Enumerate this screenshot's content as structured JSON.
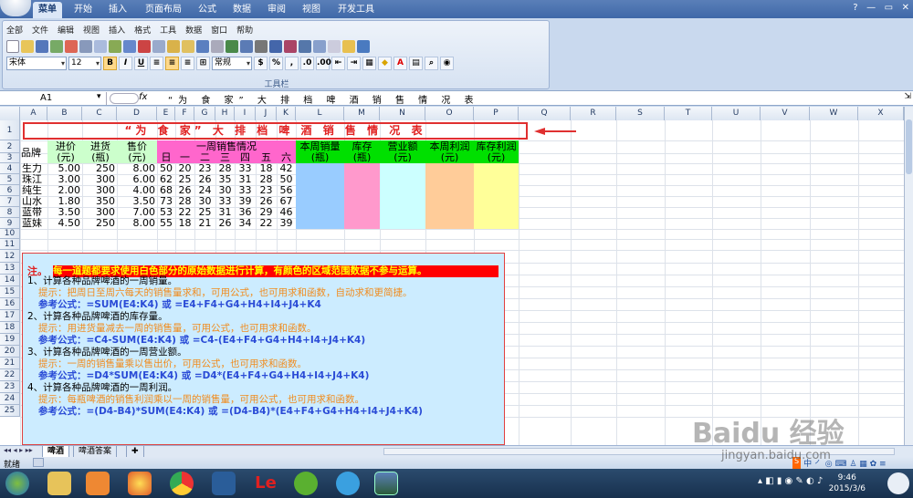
{
  "ribbon": {
    "tabs": [
      "菜单",
      "开始",
      "插入",
      "页面布局",
      "公式",
      "数据",
      "审阅",
      "视图",
      "开发工具"
    ],
    "active_tab": "菜单"
  },
  "menu": [
    "全部",
    "文件",
    "编辑",
    "视图",
    "插入",
    "格式",
    "工具",
    "数据",
    "窗口",
    "帮助"
  ],
  "toolbar": {
    "font_name": "宋体",
    "font_size": "12",
    "bold": "B",
    "italic": "I",
    "underline": "U",
    "style": "常规",
    "caption": "工具栏"
  },
  "formula_bar": {
    "cell_ref": "A1",
    "fx": "fx",
    "value": "“为 食 家” 大 排 档 啤 酒 销 售 情 况 表"
  },
  "columns": [
    "A",
    "B",
    "C",
    "D",
    "E",
    "F",
    "G",
    "H",
    "I",
    "J",
    "K",
    "L",
    "M",
    "N",
    "O",
    "P",
    "Q",
    "R",
    "S",
    "T",
    "U",
    "V",
    "W",
    "X"
  ],
  "rows": [
    "1",
    "2",
    "3",
    "4",
    "5",
    "6",
    "7",
    "8",
    "9",
    "10",
    "11",
    "12",
    "13",
    "14",
    "15",
    "16",
    "17",
    "18",
    "19",
    "20",
    "21",
    "22",
    "23",
    "24",
    "25"
  ],
  "sheet": {
    "title": "“为 食 家” 大 排 档 啤 酒 销 售 情 况 表",
    "hdr_brand": "品牌",
    "hdr_buy": "进价",
    "hdr_buy_u": "(元)",
    "hdr_stock": "进货",
    "hdr_stock_u": "(瓶)",
    "hdr_sell": "售价",
    "hdr_sell_u": "(元)",
    "hdr_week": "一周销售情况",
    "days": [
      "日",
      "一",
      "二",
      "三",
      "四",
      "五",
      "六"
    ],
    "hdr_l1": "本周销量",
    "hdr_l2": "(瓶)",
    "hdr_m1": "库存",
    "hdr_m2": "(瓶)",
    "hdr_n1": "营业额",
    "hdr_n2": "(元)",
    "hdr_o1": "本周利润",
    "hdr_o2": "(元)",
    "hdr_p1": "库存利润",
    "hdr_p2": "(元)",
    "data": [
      {
        "brand": "生力",
        "buy": "5.00",
        "stock": "250",
        "sell": "8.00",
        "days": [
          "50",
          "20",
          "23",
          "28",
          "33",
          "18",
          "42"
        ]
      },
      {
        "brand": "珠江",
        "buy": "3.00",
        "stock": "300",
        "sell": "6.00",
        "days": [
          "62",
          "25",
          "26",
          "35",
          "31",
          "28",
          "50"
        ]
      },
      {
        "brand": "纯生",
        "buy": "2.00",
        "stock": "300",
        "sell": "4.00",
        "days": [
          "68",
          "26",
          "24",
          "30",
          "33",
          "23",
          "56"
        ]
      },
      {
        "brand": "山水",
        "buy": "1.80",
        "stock": "350",
        "sell": "3.50",
        "days": [
          "73",
          "28",
          "30",
          "33",
          "39",
          "26",
          "67"
        ]
      },
      {
        "brand": "蓝带",
        "buy": "3.50",
        "stock": "300",
        "sell": "7.00",
        "days": [
          "53",
          "22",
          "25",
          "31",
          "36",
          "29",
          "46"
        ]
      },
      {
        "brand": "蓝妹",
        "buy": "4.50",
        "stock": "250",
        "sell": "8.00",
        "days": [
          "55",
          "18",
          "21",
          "26",
          "34",
          "22",
          "39"
        ]
      }
    ],
    "notes": {
      "lead": "注。",
      "red_banner": "每一道题都要求使用白色部分的原始数据进行计算，有颜色的区域范围数据不参与运算。",
      "q1": "1、计算各种品牌啤酒的一周销量。",
      "h1": "提示：把周日至周六每天的销售量求和，可用公式，也可用求和函数，自动求和更简捷。",
      "f1": "参考公式：=SUM(E4:K4)   或    =E4+F4+G4+H4+I4+J4+K4",
      "q2": "2、计算各种品牌啤酒的库存量。",
      "h2": "提示：用进货量减去一周的销售量，可用公式，也可用求和函数。",
      "f2": "参考公式：=C4-SUM(E4:K4)    或   =C4-(E4+F4+G4+H4+I4+J4+K4)",
      "q3": "3、计算各种品牌啤酒的一周营业额。",
      "h3": "提示：一周的销售量乘以售出价，可用公式，也可用求和函数。",
      "f3": "参考公式：=D4*SUM(E4:K4)    或    =D4*(E4+F4+G4+H4+I4+J4+K4)",
      "q4": "4、计算各种品牌啤酒的一周利润。",
      "h4": "提示：每瓶啤酒的销售利润乘以一周的销售量，可用公式，也可用求和函数。",
      "f4": "参考公式：=(D4-B4)*SUM(E4:K4)    或    =(D4-B4)*(E4+F4+G4+H4+I4+J4+K4)"
    }
  },
  "sheet_tabs": [
    "啤酒",
    "啤酒答案"
  ],
  "status": {
    "ready": "就绪"
  },
  "clock": {
    "time": "9:46",
    "date": "2015/3/6"
  },
  "watermark": {
    "brand": "Baidu 经验",
    "url": "jingyan.baidu.com"
  }
}
